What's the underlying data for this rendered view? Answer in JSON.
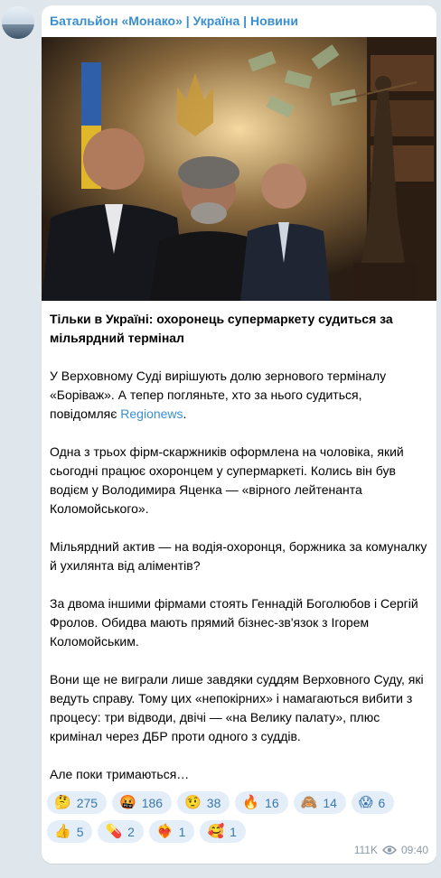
{
  "channel": {
    "name": "Батальйон «Монако» | Україна | Новини"
  },
  "post": {
    "title": "Тільки в Україні: охоронець супермаркету судиться за мільярдний термінал",
    "p1_before": "У Верховному Суді вирішують долю зернового терміналу «Боріваж». А тепер погляньте, хто за нього судиться, повідомляє ",
    "p1_link": "Regionews",
    "p1_after": ".",
    "p2": "Одна з трьох фірм-скаржників оформлена на чоловіка, який сьогодні працює охоронцем у супермаркеті. Колись він був водієм у Володимира Яценка — «вірного лейтенанта Коломойського».",
    "p3": "Мільярдний актив — на водія-охоронця, боржника за комуналку й ухилянта від аліментів?",
    "p4": "За двома іншими фірмами стоять Геннадій Боголюбов і Сергій Фролов. Обидва мають прямий бізнес-зв'язок з Ігорем Коломойським.",
    "p5": "Вони ще не виграли лише завдяки суддям Верховного Суду, які ведуть справу. Тому цих «непокірних» і намагаються вибити з процесу: три відводи, двічі — «на Велику палату», плюс кримінал через ДБР проти одного з суддів.",
    "p6": "Але поки тримаються…"
  },
  "reactions": [
    {
      "emoji": "🤔",
      "icon": "thinking-face-icon",
      "count": "275"
    },
    {
      "emoji": "🤬",
      "icon": "angry-face-icon",
      "count": "186"
    },
    {
      "emoji": "🤨",
      "icon": "raised-eyebrow-face-icon",
      "count": "38"
    },
    {
      "emoji": "🔥",
      "icon": "fire-icon",
      "count": "16"
    },
    {
      "emoji": "🙈",
      "icon": "see-no-evil-monkey-icon",
      "count": "14"
    },
    {
      "emoji": "😱",
      "icon": "screaming-face-icon",
      "count": "6"
    },
    {
      "emoji": "👍",
      "icon": "thumbs-up-icon",
      "count": "5"
    },
    {
      "emoji": "💊",
      "icon": "pill-icon",
      "count": "2"
    },
    {
      "emoji": "❤‍🔥",
      "icon": "heart-on-fire-icon",
      "count": "1"
    },
    {
      "emoji": "🥰",
      "icon": "smiling-face-hearts-icon",
      "count": "1"
    }
  ],
  "meta": {
    "views": "111K",
    "time": "09:40"
  },
  "colors": {
    "link": "#3a8fd0",
    "reaction_bg": "#e4eef8",
    "bubble_bg": "#ffffff",
    "page_bg": "#dfe6ec"
  }
}
